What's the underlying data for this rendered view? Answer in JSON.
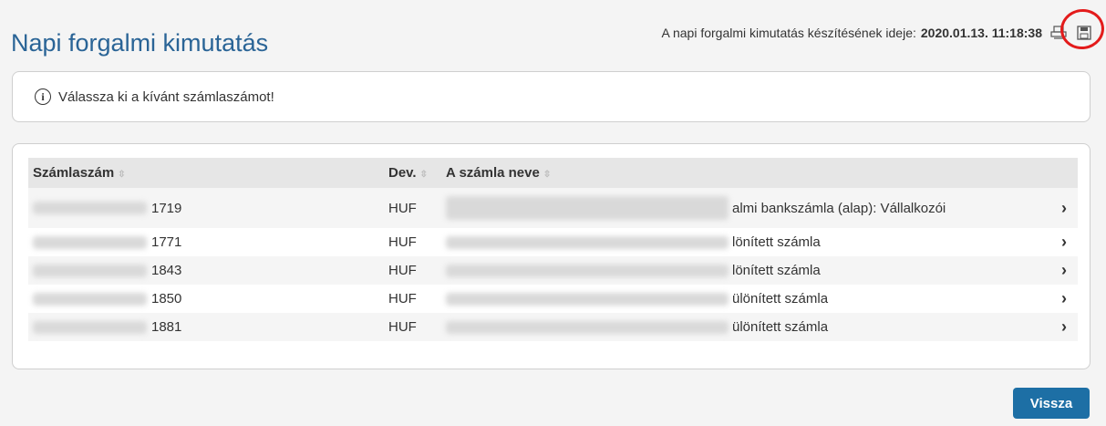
{
  "page": {
    "title": "Napi forgalmi kimutatás",
    "timestamp_label": "A napi forgalmi kimutatás készítésének ideje:",
    "timestamp_value": "2020.01.13. 11:18:38"
  },
  "icons": {
    "print": "printer-icon",
    "save": "floppy-disk-icon",
    "info": "info-icon",
    "row_action": "chevron-right-icon"
  },
  "info_message": "Válassza ki a kívánt számlaszámot!",
  "table": {
    "headers": {
      "account": "Számlaszám",
      "currency": "Dev.",
      "name": "A számla neve"
    },
    "rows": [
      {
        "account_suffix": "1719",
        "currency": "HUF",
        "name_visible": "almi bankszámla (alap): Vállalkozói",
        "chevron": "›"
      },
      {
        "account_suffix": "1771",
        "currency": "HUF",
        "name_visible": "lönített számla",
        "chevron": "›"
      },
      {
        "account_suffix": "1843",
        "currency": "HUF",
        "name_visible": "lönített számla",
        "chevron": "›"
      },
      {
        "account_suffix": "1850",
        "currency": "HUF",
        "name_visible": "ülönített számla",
        "chevron": "›"
      },
      {
        "account_suffix": "1881",
        "currency": "HUF",
        "name_visible": "ülönített számla",
        "chevron": "›"
      }
    ]
  },
  "buttons": {
    "back": "Vissza"
  },
  "colors": {
    "title": "#2a6496",
    "button": "#1d6fa5",
    "annotation": "#e31b1b"
  }
}
